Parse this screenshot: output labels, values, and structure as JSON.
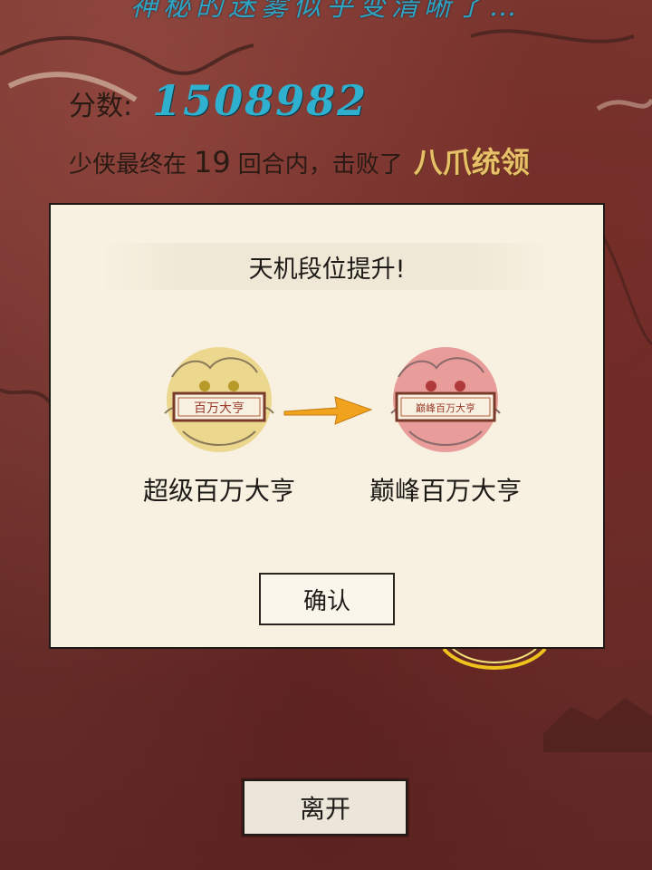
{
  "header": {
    "title": "神秘的迷雾似乎变清晰了…"
  },
  "score": {
    "label": "分数:",
    "value": "1508982"
  },
  "result": {
    "prefix": "少侠最终在",
    "rounds": "19",
    "middle": "回合内，击败了",
    "boss": "八爪统领"
  },
  "modal": {
    "title": "天机段位提升!",
    "old_rank": {
      "label": "超级百万大亨",
      "seal_text": "百万大亨",
      "color": "#e0c24a"
    },
    "new_rank": {
      "label": "巅峰百万大亨",
      "seal_text": "巅峰百万大亨",
      "color": "#e0666a"
    },
    "confirm_label": "确认"
  },
  "footer": {
    "leave_label": "离开"
  },
  "colors": {
    "score_accent": "#2fb0cf",
    "boss_accent": "#e9c06a",
    "arrow": "#f2a31e"
  }
}
